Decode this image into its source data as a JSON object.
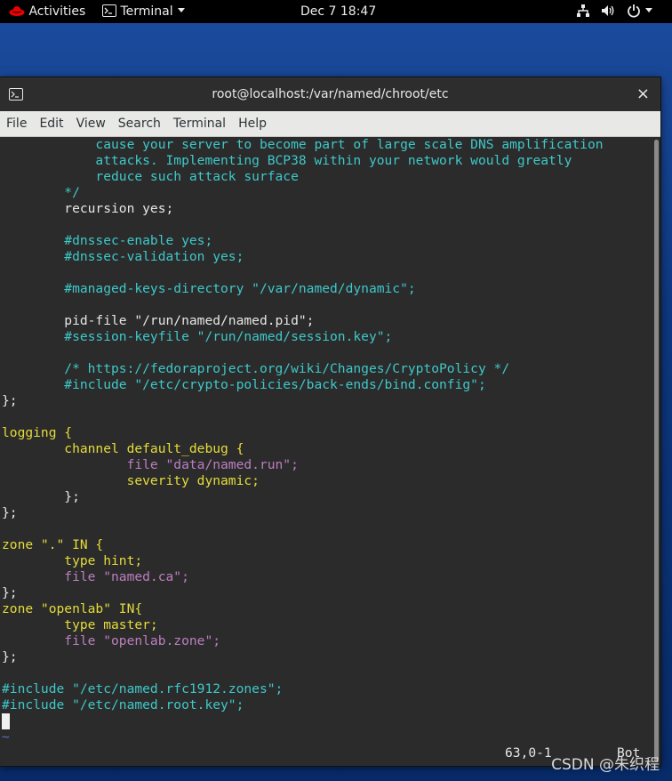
{
  "topbar": {
    "activities": "Activities",
    "app_name": "Terminal",
    "datetime": "Dec 7  18:47"
  },
  "window": {
    "title": "root@localhost:/var/named/chroot/etc",
    "close": "×"
  },
  "menu": [
    "File",
    "Edit",
    "View",
    "Search",
    "Terminal",
    "Help"
  ],
  "editor": {
    "lines": [
      "            cause your server to become part of large scale DNS amplification",
      "            attacks. Implementing BCP38 within your network would greatly",
      "            reduce such attack surface",
      "        */",
      "        recursion yes;",
      "",
      "        #dnssec-enable yes;",
      "        #dnssec-validation yes;",
      "",
      "        #managed-keys-directory \"/var/named/dynamic\";",
      "",
      "        pid-file \"/run/named/named.pid\";",
      "        #session-keyfile \"/run/named/session.key\";",
      "",
      "        /* https://fedoraproject.org/wiki/Changes/CryptoPolicy */",
      "        #include \"/etc/crypto-policies/back-ends/bind.config\";",
      "};",
      "",
      "logging {",
      "        channel default_debug {",
      "                file \"data/named.run\";",
      "                severity dynamic;",
      "        };",
      "};",
      "",
      "zone \".\" IN {",
      "        type hint;",
      "        file \"named.ca\";",
      "};",
      "zone \"openlab\" IN{",
      "        type master;",
      "        file \"openlab.zone\";",
      "};",
      "",
      "#include \"/etc/named.rfc1912.zones\";",
      "#include \"/etc/named.root.key\";",
      "",
      "~"
    ],
    "status_position": "63,0-1",
    "status_scroll": "Bot"
  },
  "watermark": "CSDN @朱织程",
  "colors": {
    "comment": "#3fc8c9",
    "keyword": "#e5dc3a",
    "string": "#bb7fbf",
    "background": "#2b2b2b"
  }
}
